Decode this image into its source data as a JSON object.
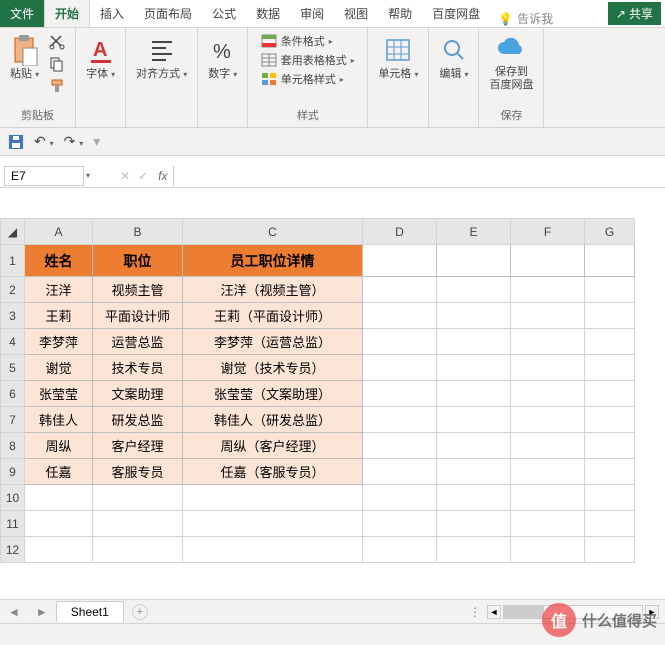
{
  "tabs": {
    "file": "文件",
    "home": "开始",
    "insert": "插入",
    "layout": "页面布局",
    "formula": "公式",
    "data": "数据",
    "review": "审阅",
    "view": "视图",
    "help": "帮助",
    "baidu": "百度网盘",
    "tellme": "告诉我",
    "share": "共享"
  },
  "ribbon": {
    "clipboard": {
      "paste": "粘贴",
      "label": "剪贴板"
    },
    "font": {
      "btn": "字体",
      "label": ""
    },
    "align": {
      "btn": "对齐方式",
      "label": ""
    },
    "number": {
      "btn": "数字",
      "label": ""
    },
    "styles": {
      "cond": "条件格式",
      "table": "套用表格格式",
      "cell": "单元格样式",
      "label": "样式"
    },
    "cells": {
      "btn": "单元格"
    },
    "editing": {
      "btn": "编辑"
    },
    "save": {
      "btn": "保存到\n百度网盘",
      "label": "保存"
    }
  },
  "namebox": "E7",
  "columns": [
    "A",
    "B",
    "C",
    "D",
    "E",
    "F",
    "G"
  ],
  "headers": {
    "a": "姓名",
    "b": "职位",
    "c": "员工职位详情"
  },
  "rows": [
    {
      "a": "汪洋",
      "b": "视频主管",
      "c": "汪洋（视频主管）"
    },
    {
      "a": "王莉",
      "b": "平面设计师",
      "c": "王莉（平面设计师）"
    },
    {
      "a": "李梦萍",
      "b": "运营总监",
      "c": "李梦萍（运营总监）"
    },
    {
      "a": "谢觉",
      "b": "技术专员",
      "c": "谢觉（技术专员）"
    },
    {
      "a": "张莹莹",
      "b": "文案助理",
      "c": "张莹莹（文案助理）"
    },
    {
      "a": "韩佳人",
      "b": "研发总监",
      "c": "韩佳人（研发总监）"
    },
    {
      "a": "周纵",
      "b": "客户经理",
      "c": "周纵（客户经理）"
    },
    {
      "a": "任嘉",
      "b": "客服专员",
      "c": "任嘉（客服专员）"
    }
  ],
  "sheet": "Sheet1",
  "watermark": {
    "logo": "值",
    "text": "什么值得买"
  }
}
